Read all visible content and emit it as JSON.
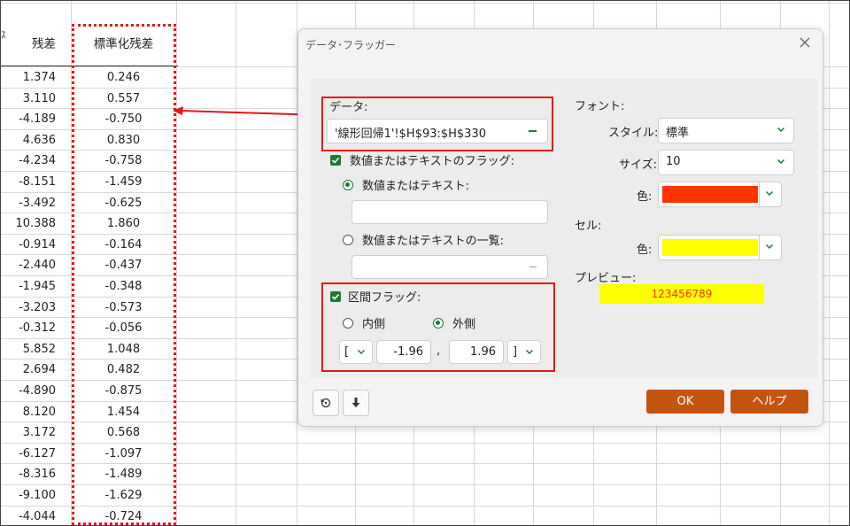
{
  "sheet": {
    "left_edge_header": "ｽ",
    "headers": {
      "residual": "残差",
      "std_residual": "標準化残差"
    },
    "rows": [
      {
        "residual": "1.374",
        "std": "0.246"
      },
      {
        "residual": "3.110",
        "std": "0.557"
      },
      {
        "residual": "-4.189",
        "std": "-0.750"
      },
      {
        "residual": "4.636",
        "std": "0.830"
      },
      {
        "residual": "-4.234",
        "std": "-0.758"
      },
      {
        "residual": "-8.151",
        "std": "-1.459"
      },
      {
        "residual": "-3.492",
        "std": "-0.625"
      },
      {
        "residual": "10.388",
        "std": "1.860"
      },
      {
        "residual": "-0.914",
        "std": "-0.164"
      },
      {
        "residual": "-2.440",
        "std": "-0.437"
      },
      {
        "residual": "-1.945",
        "std": "-0.348"
      },
      {
        "residual": "-3.203",
        "std": "-0.573"
      },
      {
        "residual": "-0.312",
        "std": "-0.056"
      },
      {
        "residual": "5.852",
        "std": "1.048"
      },
      {
        "residual": "2.694",
        "std": "0.482"
      },
      {
        "residual": "-4.890",
        "std": "-0.875"
      },
      {
        "residual": "8.120",
        "std": "1.454"
      },
      {
        "residual": "3.172",
        "std": "0.568"
      },
      {
        "residual": "-6.127",
        "std": "-1.097"
      },
      {
        "residual": "-8.316",
        "std": "-1.489"
      },
      {
        "residual": "-9.100",
        "std": "-1.629"
      },
      {
        "residual": "-4.044",
        "std": "-0.724"
      }
    ]
  },
  "dialog": {
    "title": "データ･フラッガー",
    "close_icon": "close-icon",
    "data_label": "データ:",
    "data_range": "'線形回帰1'!$H$93:$H$330",
    "flag_value_text_label": "数値またはテキストのフラッグ:",
    "radio_value_text_label": "数値またはテキスト:",
    "value_text_input": "",
    "radio_list_label": "数値またはテキストの一覧:",
    "list_input": "",
    "interval_flag_label": "区間フラッグ:",
    "inside_label": "内側",
    "outside_label": "外側",
    "lower_bracket": "[",
    "lower_value": "-1.96",
    "comma": ",",
    "upper_value": "1.96",
    "upper_bracket": "]",
    "font_label": "フォント:",
    "style_label": "スタイル:",
    "style_value": "標準",
    "size_label": "サイズ:",
    "size_value": "10",
    "font_color_label": "色:",
    "font_color": "#ff3300",
    "cell_label": "セル:",
    "cell_color_label": "色:",
    "cell_color": "#ffff00",
    "preview_label": "プレビュー:",
    "preview_text": "123456789",
    "ok_label": "OK",
    "help_label": "ヘルプ",
    "accent": "#c55411",
    "check_color": "#1d7a35",
    "highlight_color": "#e8141a"
  }
}
